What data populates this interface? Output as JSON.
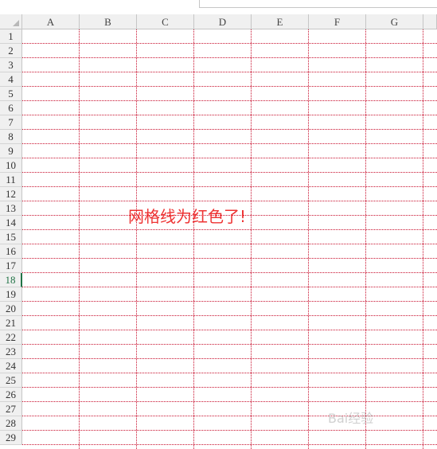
{
  "spreadsheet": {
    "columns": [
      "A",
      "B",
      "C",
      "D",
      "E",
      "F",
      "G"
    ],
    "rows": [
      "1",
      "2",
      "3",
      "4",
      "5",
      "6",
      "7",
      "8",
      "9",
      "10",
      "11",
      "12",
      "13",
      "14",
      "15",
      "16",
      "17",
      "18",
      "19",
      "20",
      "21",
      "22",
      "23",
      "24",
      "25",
      "26",
      "27",
      "28",
      "29"
    ],
    "active_row": "18",
    "gridline_color": "#c8102e",
    "header_color": "#f0f0f0",
    "active_color": "#217346"
  },
  "annotation": {
    "text": "网格线为红色了!",
    "color": "#ee3333"
  },
  "watermark": {
    "text": "Bai经验"
  }
}
